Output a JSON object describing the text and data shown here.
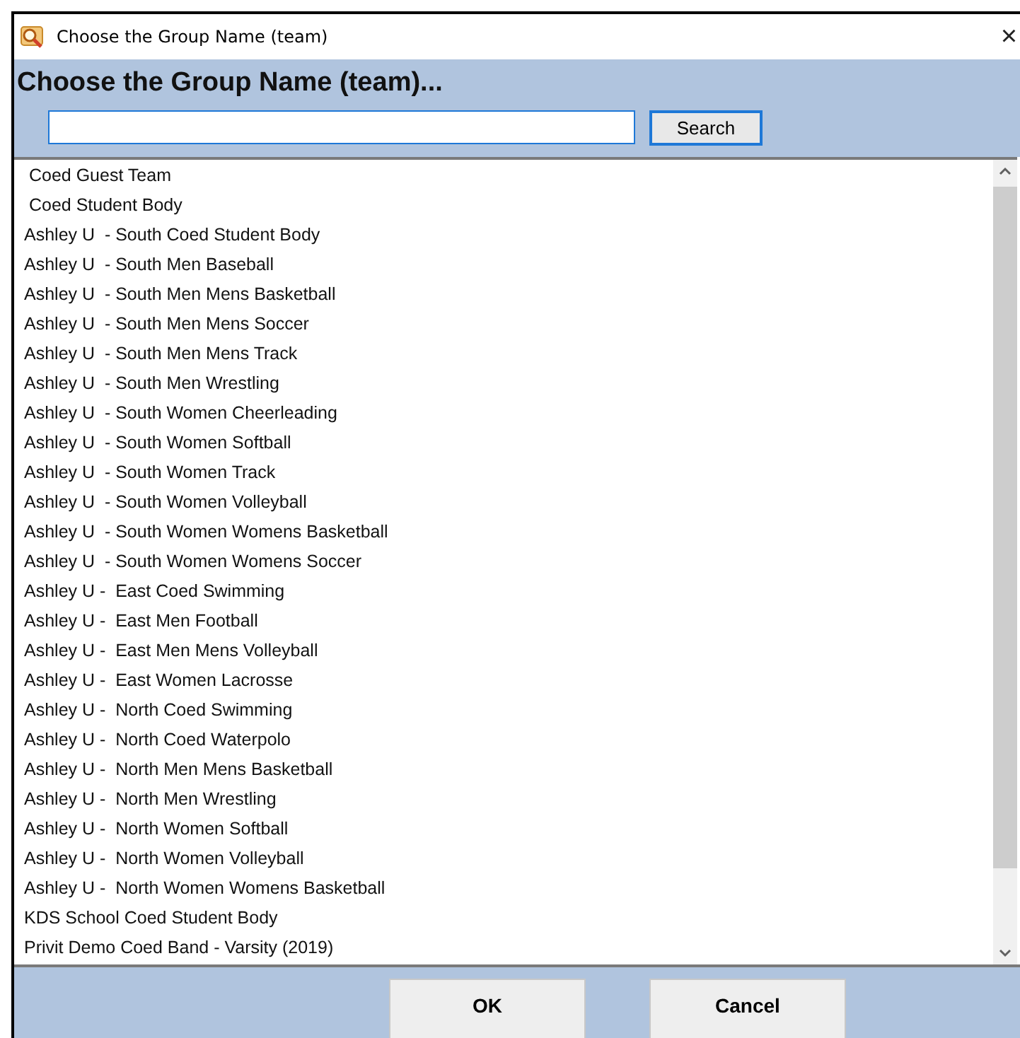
{
  "window": {
    "title": "Choose the Group Name (team)",
    "close": "×"
  },
  "heading": "Choose the Group Name (team)...",
  "search": {
    "button": "Search"
  },
  "list": {
    "items": [
      {
        "label": " Coed Guest Team"
      },
      {
        "label": " Coed Student Body"
      },
      {
        "label": "Ashley U  - South Coed Student Body"
      },
      {
        "label": "Ashley U  - South Men Baseball"
      },
      {
        "label": "Ashley U  - South Men Mens Basketball"
      },
      {
        "label": "Ashley U  - South Men Mens Soccer"
      },
      {
        "label": "Ashley U  - South Men Mens Track"
      },
      {
        "label": "Ashley U  - South Men Wrestling"
      },
      {
        "label": "Ashley U  - South Women Cheerleading"
      },
      {
        "label": "Ashley U  - South Women Softball"
      },
      {
        "label": "Ashley U  - South Women Track"
      },
      {
        "label": "Ashley U  - South Women Volleyball"
      },
      {
        "label": "Ashley U  - South Women Womens Basketball"
      },
      {
        "label": "Ashley U  - South Women Womens Soccer"
      },
      {
        "label": "Ashley U -  East Coed Swimming"
      },
      {
        "label": "Ashley U -  East Men Football"
      },
      {
        "label": "Ashley U -  East Men Mens Volleyball"
      },
      {
        "label": "Ashley U -  East Women Lacrosse"
      },
      {
        "label": "Ashley U -  North Coed Swimming"
      },
      {
        "label": "Ashley U -  North Coed Waterpolo"
      },
      {
        "label": "Ashley U -  North Men Mens Basketball"
      },
      {
        "label": "Ashley U -  North Men Wrestling"
      },
      {
        "label": "Ashley U -  North Women Softball"
      },
      {
        "label": "Ashley U -  North Women Volleyball"
      },
      {
        "label": "Ashley U -  North Women Womens Basketball"
      },
      {
        "label": "KDS School Coed Student Body"
      },
      {
        "label": "Privit Demo Coed Band - Varsity (2019)"
      }
    ]
  },
  "buttons": [
    "OK",
    "Cancel"
  ]
}
